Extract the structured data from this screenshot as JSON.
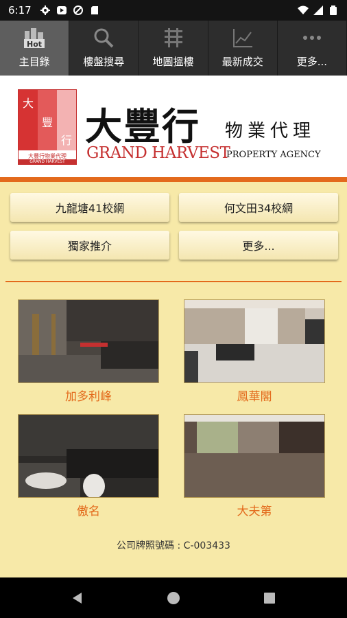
{
  "status_bar": {
    "time": "6:17",
    "left_icons": [
      "gear-icon",
      "play-icon",
      "nosync-icon",
      "sdcard-icon"
    ],
    "right_icons": [
      "wifi-icon",
      "signal-icon",
      "battery-icon"
    ]
  },
  "tabs": [
    {
      "label": "主目錄",
      "icon": "hot-city-icon",
      "badge": "Hot",
      "active": true
    },
    {
      "label": "樓盤搜尋",
      "icon": "search-icon",
      "active": false
    },
    {
      "label": "地圖搵樓",
      "icon": "map-icon",
      "active": false
    },
    {
      "label": "最新成交",
      "icon": "chart-icon",
      "active": false
    },
    {
      "label": "更多...",
      "icon": "more-dots-icon",
      "active": false
    }
  ],
  "logo": {
    "mark_chars": [
      "大",
      "豐",
      "行"
    ],
    "mark_cn": "大豐行物業代理",
    "mark_en": "GRAND HARVEST",
    "brand_cn": "大豐行",
    "brand_en": "GRAND HARVEST",
    "agency_cn": "物業代理",
    "agency_en": "PROPERTY AGENCY"
  },
  "buttons": [
    {
      "label": "九龍塘41校網"
    },
    {
      "label": "何文田34校網"
    },
    {
      "label": "獨家推介"
    },
    {
      "label": "更多..."
    }
  ],
  "listings": [
    {
      "name": "加多利峰"
    },
    {
      "name": "鳳華閣"
    },
    {
      "name": "傲名"
    },
    {
      "name": "大夫第"
    }
  ],
  "license": "公司牌照號碼 : C-003433",
  "colors": {
    "accent": "#e36a1c",
    "brand_red": "#c53030",
    "background": "#f7e9a8"
  }
}
